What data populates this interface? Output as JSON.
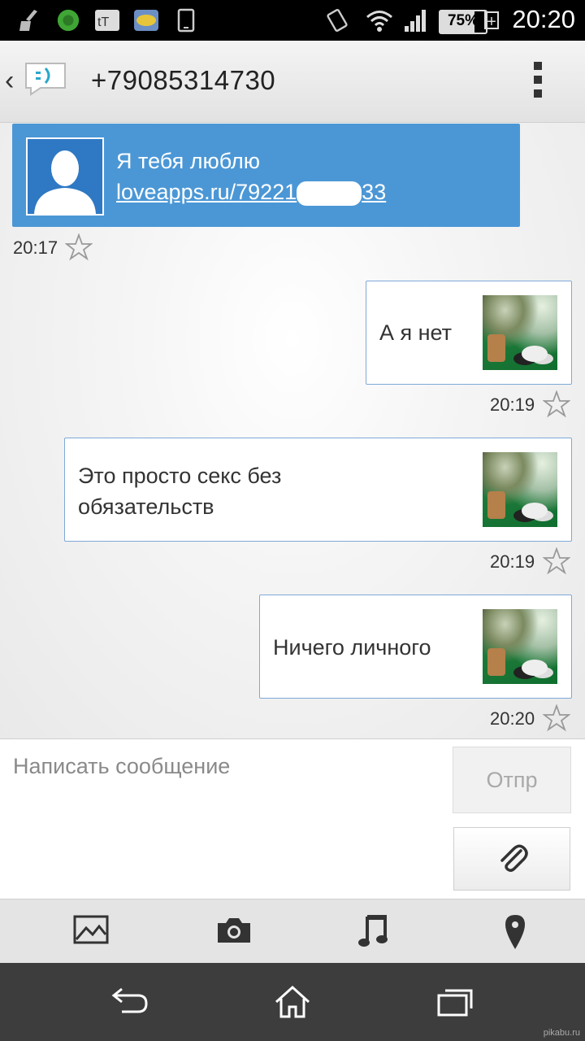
{
  "status_bar": {
    "time": "20:20",
    "battery": "75%",
    "battery_plus": "+",
    "left_icons": [
      "cleaner-icon",
      "antivirus-icon",
      "tt-app-icon",
      "imt-app-icon",
      "phone-icon"
    ],
    "right_icons": [
      "vibrate-icon",
      "wifi-icon",
      "signal-icon"
    ]
  },
  "header": {
    "back": "‹",
    "title": "+79085314730",
    "app_icon": "sms-app-icon",
    "menu_icon": "overflow-menu-icon"
  },
  "messages": [
    {
      "direction": "incoming",
      "line1": "Я тебя люблю",
      "line2": "loveapps.ru/79221",
      "line2_end": "33",
      "time": "20:17",
      "starred": false
    },
    {
      "direction": "outgoing",
      "line1": "А я нет",
      "time": "20:19",
      "starred": false
    },
    {
      "direction": "outgoing",
      "line1": "Это просто секс без",
      "line2": "обязательств",
      "time": "20:19",
      "starred": false
    },
    {
      "direction": "outgoing",
      "line1": "Ничего личного",
      "time": "20:20",
      "starred": false
    }
  ],
  "compose": {
    "placeholder": "Написать сообщение",
    "send_label": "Отпр"
  },
  "media_bar": [
    "gallery-icon",
    "camera-icon",
    "music-icon",
    "location-icon"
  ],
  "nav_bar": [
    "back-icon",
    "home-icon",
    "recents-icon"
  ],
  "watermark": "pikabu.ru",
  "colors": {
    "incoming_bubble": "#4b97d6",
    "outgoing_border": "#7fa9d8",
    "status_bar": "#000000",
    "nav_bar": "#3d3d3d"
  }
}
